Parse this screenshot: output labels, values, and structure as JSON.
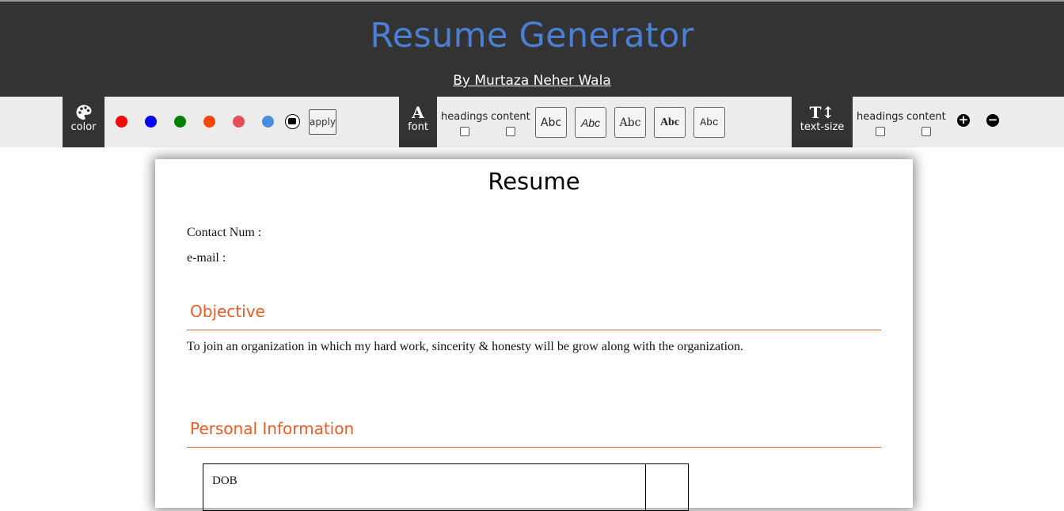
{
  "header": {
    "title": "Resume Generator",
    "byline": "By Murtaza Neher Wala"
  },
  "toolbar": {
    "color": {
      "icon": "palette-icon",
      "label": "color",
      "swatches": [
        "#ff0000",
        "#0000ff",
        "#008000",
        "#ff4500",
        "#e34e5a",
        "#4a8ce0"
      ],
      "picker_icon": "color-picker-icon",
      "apply_label": "apply"
    },
    "font": {
      "icon": "font-icon",
      "icon_glyph": "A",
      "label": "font",
      "headings_label": "headings",
      "content_label": "content",
      "samples": [
        "Abc",
        "Abc",
        "Abc",
        "Abc",
        "Abc"
      ]
    },
    "text_size": {
      "icon": "text-size-icon",
      "icon_glyph": "T↕",
      "label": "text-size",
      "headings_label": "headings",
      "content_label": "content",
      "increase_glyph": "+",
      "decrease_glyph": "−"
    }
  },
  "resume": {
    "title": "Resume",
    "contact_label": "Contact Num :",
    "email_label": "e-mail :",
    "objective_heading": "Objective",
    "objective_text": "To join an organization in which my hard work, sincerity & honesty will be grow along with the organization.",
    "personal_heading": "Personal Information",
    "table_first_label": "DOB",
    "accent_color": "#f15a22"
  }
}
